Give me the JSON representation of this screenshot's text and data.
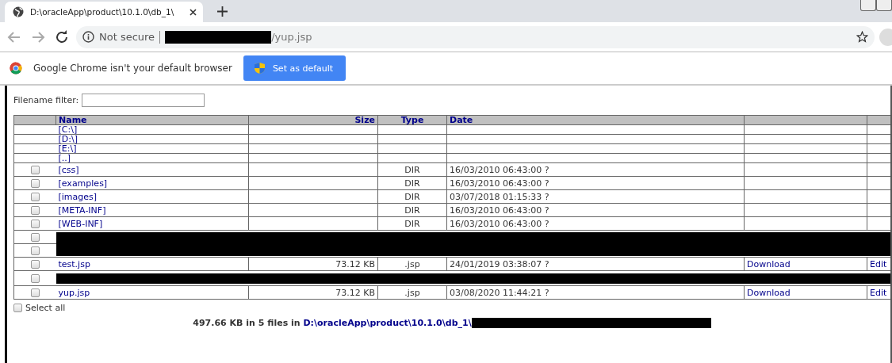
{
  "browser": {
    "tab": {
      "title": "D:\\oracleApp\\product\\10.1.0\\db_1\\",
      "selected": true
    },
    "address_bar": {
      "security": "Not secure",
      "url_suffix": "/yup.jsp",
      "redacted": true
    },
    "infobar": {
      "message": "Google Chrome isn't your default browser",
      "button": "Set as default"
    }
  },
  "page": {
    "filter": {
      "label": "Filename filter:"
    },
    "table": {
      "columns": [
        {},
        {
          "label": "Name"
        },
        {
          "label": "Size"
        },
        {
          "label": "Type"
        },
        {
          "label": "Date"
        },
        {},
        {}
      ],
      "rows": [
        {
          "kind": "drive",
          "name": "[C:\\]"
        },
        {
          "kind": "drive",
          "name": "[D:\\]"
        },
        {
          "kind": "drive",
          "name": "[E:\\]"
        },
        {
          "kind": "drive",
          "name": "[..]"
        },
        {
          "kind": "entry",
          "checked": false,
          "name": "[css]",
          "type": "DIR",
          "date": "16/03/2010 06:43:00 ?"
        },
        {
          "kind": "entry",
          "checked": false,
          "name": "[examples]",
          "type": "DIR",
          "date": "16/03/2010 06:43:00 ?"
        },
        {
          "kind": "entry",
          "checked": false,
          "name": "[images]",
          "type": "DIR",
          "date": "03/07/2018 01:15:33 ?"
        },
        {
          "kind": "entry",
          "checked": false,
          "name": "[META-INF]",
          "type": "DIR",
          "date": "16/03/2010 06:43:00 ?"
        },
        {
          "kind": "entry",
          "checked": false,
          "name": "[WEB-INF]",
          "type": "DIR",
          "date": "16/03/2010 06:43:00 ?"
        },
        {
          "kind": "redacted",
          "checkboxes": [
            {
              "checked": false
            },
            {
              "checked": false
            }
          ]
        },
        {
          "kind": "entry",
          "checked": false,
          "name": "test.jsp",
          "size": "73.12 KB",
          "type": ".jsp",
          "date": "24/01/2019 03:38:07 ?",
          "download": "Download",
          "edit": "Edit"
        },
        {
          "kind": "redacted",
          "checkboxes": [
            {
              "checked": false
            }
          ]
        },
        {
          "kind": "entry",
          "checked": false,
          "name": "yup.jsp",
          "size": "73.12 KB",
          "type": ".jsp",
          "date": "03/08/2020 11:44:21 ?",
          "download": "Download",
          "edit": "Edit"
        }
      ]
    },
    "select_all": {
      "label": "Select all",
      "checked": false
    },
    "summary": {
      "text": "497.66 KB in 5 files in ",
      "path": "D:\\oracleApp\\product\\10.1.0\\db_1\\",
      "redacted": true
    }
  }
}
